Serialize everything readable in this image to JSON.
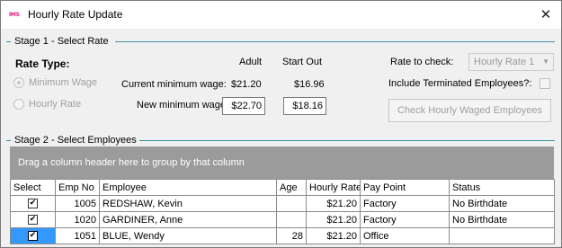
{
  "window": {
    "app_icon_text": "IMS",
    "title": "Hourly Rate Update",
    "close_glyph": "✕"
  },
  "stage1": {
    "header": "Stage 1 - Select Rate",
    "rate_type_label": "Rate Type:",
    "rate_options": [
      {
        "label": "Minimum Wage",
        "checked": true,
        "enabled": false
      },
      {
        "label": "Hourly Rate",
        "checked": false,
        "enabled": false
      }
    ],
    "col_adult": "Adult",
    "col_start_out": "Start Out",
    "current_min_label": "Current minimum wage:",
    "current_adult": "$21.20",
    "current_start_out": "$16.96",
    "new_min_label": "New minimum wage:",
    "new_adult": "$22.70",
    "new_start_out": "$18.16",
    "rate_to_check_label": "Rate to check:",
    "rate_to_check_value": "Hourly Rate 1",
    "include_terminated_label": "Include Terminated Employees?:",
    "include_terminated_checked": false,
    "check_button_label": "Check Hourly Waged Employees"
  },
  "stage2": {
    "header": "Stage 2 - Select Employees",
    "group_panel_text": "Drag a column header here to group by that column",
    "columns": [
      "Select",
      "Emp No",
      "Employee",
      "Age",
      "Hourly Rate",
      "Pay Point",
      "Status"
    ],
    "rows": [
      {
        "select": true,
        "emp_no": "1005",
        "employee": "REDSHAW, Kevin",
        "age": "",
        "hourly_rate": "$21.20",
        "pay_point": "Factory",
        "status": "No Birthdate"
      },
      {
        "select": true,
        "emp_no": "1020",
        "employee": "GARDINER, Anne",
        "age": "",
        "hourly_rate": "$21.20",
        "pay_point": "Factory",
        "status": "No Birthdate"
      },
      {
        "select": true,
        "emp_no": "1051",
        "employee": "BLUE, Wendy",
        "age": "28",
        "hourly_rate": "$21.20",
        "pay_point": "Office",
        "status": ""
      }
    ]
  },
  "colors": {
    "group_line": "#3d8fa5",
    "group_panel": "#9b9b9b",
    "selection": "#3399ff",
    "app_icon": "#d81b80"
  }
}
